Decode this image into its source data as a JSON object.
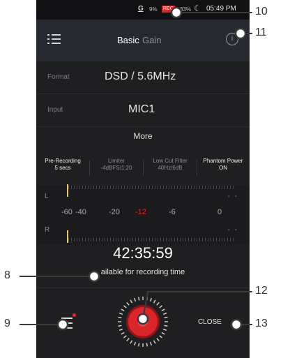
{
  "status_bar": {
    "g_icon": "G",
    "battery1": "9%",
    "rec_badge": "REC",
    "battery2": "33%",
    "moon_icon": "moon-icon",
    "time": "05:49 PM"
  },
  "header": {
    "menu_icon": "menu-list-icon",
    "tabs": [
      "Basic",
      "Gain"
    ],
    "info_icon": "info-icon"
  },
  "format": {
    "label": "Format",
    "value": "DSD / 5.6MHz"
  },
  "input": {
    "label": "Input",
    "value": "MIC1"
  },
  "more": "More",
  "params": [
    {
      "name": "Pre-Recording",
      "value": "5 secs",
      "active": true
    },
    {
      "name": "Limiter",
      "value": "-4dBFS/1:20",
      "active": false
    },
    {
      "name": "Low Cut Filter",
      "value": "40Hz/6dB",
      "active": false
    },
    {
      "name": "Phantom Power",
      "value": "ON",
      "active": true
    }
  ],
  "meter": {
    "left_label": "L",
    "right_label": "R",
    "left_reading": "- -",
    "right_reading": "- -",
    "ticks": [
      "-60",
      "-40",
      "-20",
      "-12",
      "-6",
      "0"
    ]
  },
  "recording": {
    "available_time": "42:35:59",
    "available_label": "ailable for recording time"
  },
  "controls": {
    "list_icon": "recording-list-icon",
    "rec_button": "record-button",
    "close_label": "CLOSE"
  },
  "callouts": [
    "10",
    "11",
    "8",
    "12",
    "9",
    "13"
  ],
  "colors": {
    "accent_red": "#d8262c",
    "level_yellow": "#e6c86a",
    "background": "#1f1f21"
  }
}
